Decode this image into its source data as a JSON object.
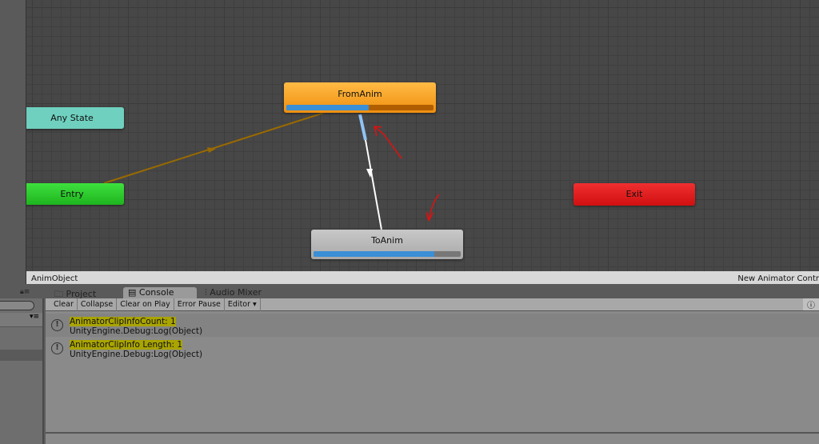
{
  "graph": {
    "nodes": {
      "any_state": {
        "label": "Any State",
        "color": "#6fd0bf"
      },
      "entry": {
        "label": "Entry",
        "color": "#2ecc2e"
      },
      "from_anim": {
        "label": "FromAnim",
        "color": "#f7a52c",
        "progress": 0.56
      },
      "to_anim": {
        "label": "ToAnim",
        "color": "#b5b5b5",
        "progress": 0.82
      },
      "exit": {
        "label": "Exit",
        "color": "#e12020"
      }
    }
  },
  "status": {
    "left": "AnimObject",
    "right": "New Animator Contr"
  },
  "tabs": [
    {
      "label": "Project",
      "icon": "folder-icon"
    },
    {
      "label": "Console",
      "icon": "console-icon"
    },
    {
      "label": "Audio Mixer",
      "icon": "mixer-icon"
    }
  ],
  "toolbar": {
    "clear": "Clear",
    "collapse": "Collapse",
    "clear_on_play": "Clear on Play",
    "error_pause": "Error Pause",
    "editor": "Editor ▾"
  },
  "logs": [
    {
      "message": "AnimatorClipInfoCount: 1",
      "trace": "UnityEngine.Debug:Log(Object)"
    },
    {
      "message": "AnimatorClipInfo Length: 1",
      "trace": "UnityEngine.Debug:Log(Object)"
    }
  ]
}
